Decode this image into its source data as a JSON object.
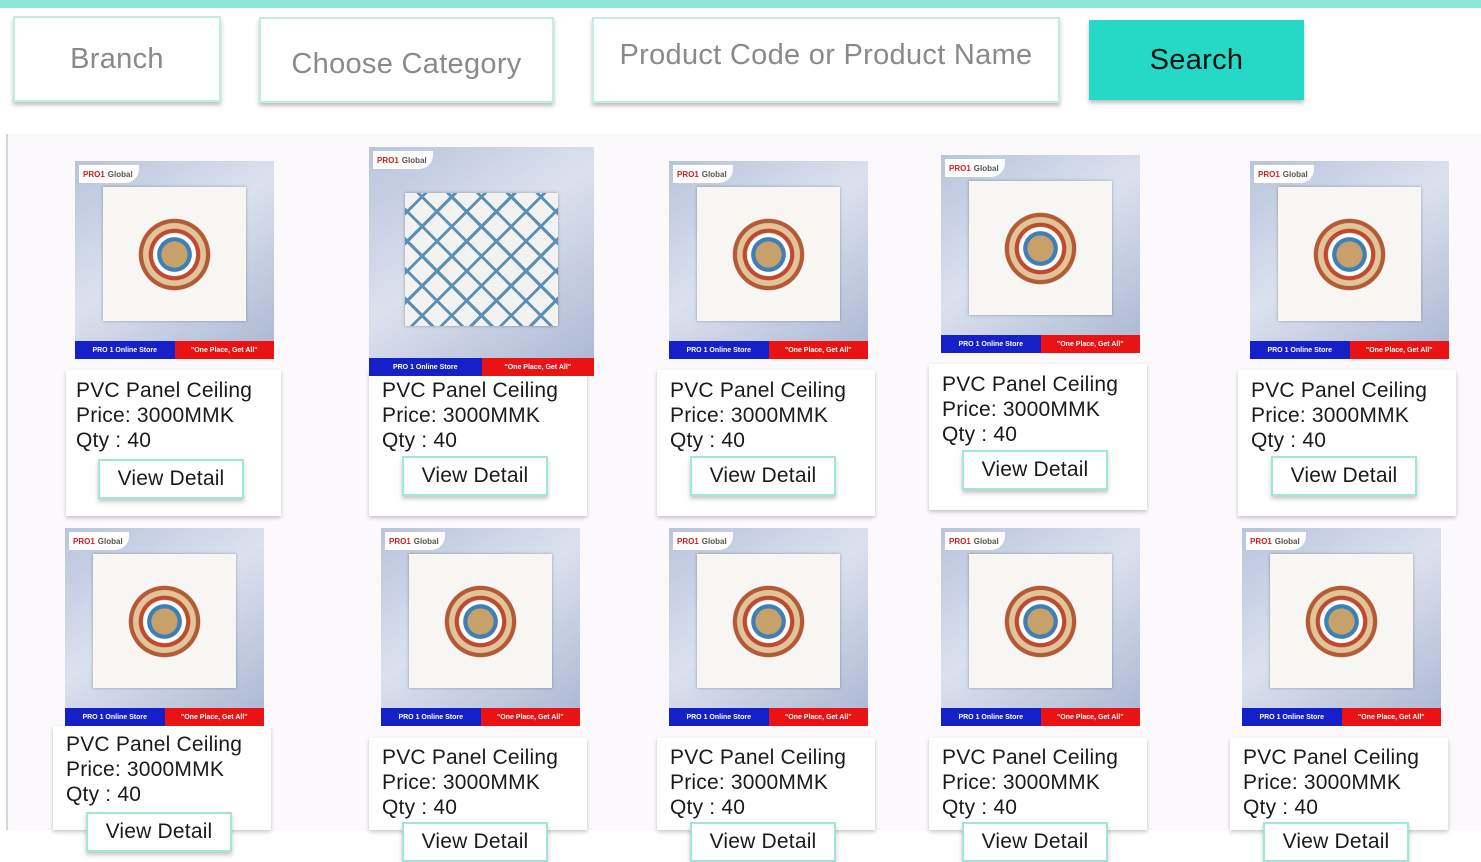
{
  "filters": {
    "branch_placeholder": "Branch",
    "category_placeholder": "Choose Category",
    "search_placeholder": "Product Code or Product Name",
    "search_button": "Search"
  },
  "thumbnail": {
    "logo_left": "PRO1",
    "logo_right": "Global",
    "band_left": "PRO 1 Online Store",
    "band_right": "\"One Place, Get All\""
  },
  "colors": {
    "accent": "#26d9c6",
    "top_bar": "#8fe6d6",
    "band_blue": "#1520c8",
    "band_red": "#ea1212"
  },
  "products": [
    {
      "name": "PVC Panel Ceiling",
      "price": "Price: 3000MMK",
      "qty": "Qty : 40",
      "button": "View Detail",
      "pattern": "floral"
    },
    {
      "name": "PVC Panel Ceiling",
      "price": "Price: 3000MMK",
      "qty": "Qty : 40",
      "button": "View Detail",
      "pattern": "lattice"
    },
    {
      "name": "PVC Panel Ceiling",
      "price": "Price: 3000MMK",
      "qty": "Qty : 40",
      "button": "View Detail",
      "pattern": "floral"
    },
    {
      "name": "PVC Panel Ceiling",
      "price": "Price: 3000MMK",
      "qty": "Qty : 40",
      "button": "View Detail",
      "pattern": "floral"
    },
    {
      "name": "PVC Panel Ceiling",
      "price": "Price: 3000MMK",
      "qty": "Qty : 40",
      "button": "View Detail",
      "pattern": "floral"
    },
    {
      "name": "PVC Panel Ceiling",
      "price": "Price: 3000MMK",
      "qty": "Qty : 40",
      "button": "View Detail",
      "pattern": "floral"
    },
    {
      "name": "PVC Panel Ceiling",
      "price": "Price: 3000MMK",
      "qty": "Qty : 40",
      "button": "View Detail",
      "pattern": "floral"
    },
    {
      "name": "PVC Panel Ceiling",
      "price": "Price: 3000MMK",
      "qty": "Qty : 40",
      "button": "View Detail",
      "pattern": "floral"
    },
    {
      "name": "PVC Panel Ceiling",
      "price": "Price: 3000MMK",
      "qty": "Qty : 40",
      "button": "View Detail",
      "pattern": "floral"
    },
    {
      "name": "PVC Panel Ceiling",
      "price": "Price: 3000MMK",
      "qty": "Qty : 40",
      "button": "View Detail",
      "pattern": "floral"
    }
  ]
}
